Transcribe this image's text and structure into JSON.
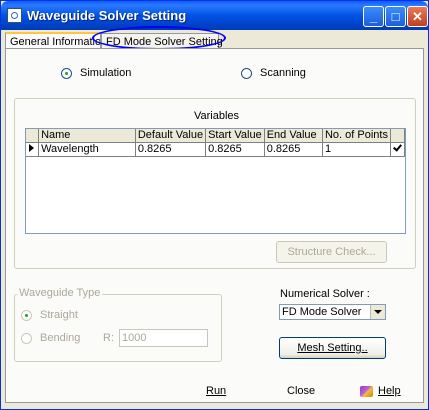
{
  "window": {
    "title": "Waveguide Solver Setting",
    "minimize": "_",
    "maximize": "□",
    "close": "✕"
  },
  "tabs": [
    {
      "label": "General Information",
      "active": true
    },
    {
      "label": "FD Mode Solver Setting",
      "active": false
    }
  ],
  "mode": {
    "simulation_label": "Simulation",
    "scanning_label": "Scanning",
    "selected": "Simulation"
  },
  "variables": {
    "title": "Variables",
    "columns": [
      "Name",
      "Default Value",
      "Start Value",
      "End Value",
      "No. of Points"
    ],
    "rows": [
      {
        "name": "Wavelength",
        "default": "0.8265",
        "start": "0.8265",
        "end": "0.8265",
        "points": "1",
        "checked": true
      }
    ],
    "structure_check_label": "Structure Check..."
  },
  "waveguide_type": {
    "title": "Waveguide Type",
    "straight_label": "Straight",
    "bending_label": "Bending",
    "r_label": "R:",
    "r_value": "1000"
  },
  "numerical_solver": {
    "label": "Numerical Solver :",
    "selected": "FD Mode Solver",
    "mesh_setting_label": "Mesh Setting.."
  },
  "footer": {
    "run_label": "Run",
    "close_label": "Close",
    "help_label": "Help"
  },
  "colors": {
    "titlebar": "#0053e3",
    "highlight_ellipse": "#0000ff"
  }
}
